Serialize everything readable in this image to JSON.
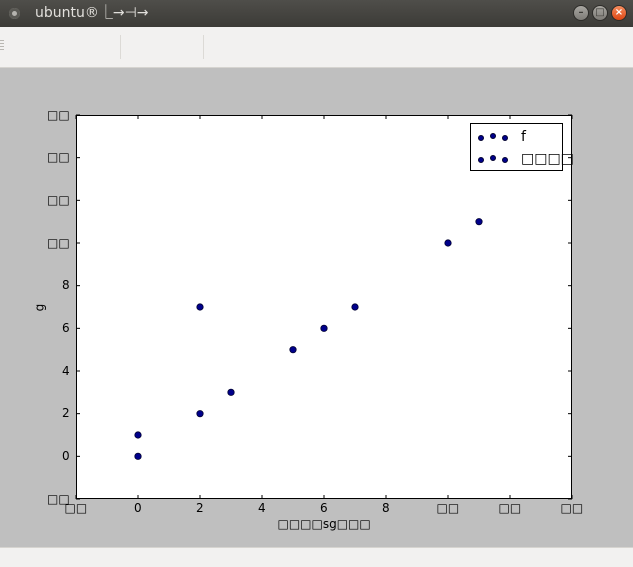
{
  "window": {
    "title": "ubuntu®⎿→⊣→",
    "minimize_glyph": "–",
    "maximize_glyph": "□",
    "close_glyph": "×"
  },
  "chart_data": {
    "type": "scatter",
    "title": "",
    "xlabel": "□□□□sg□□□",
    "ylabel": "g",
    "xlim": [
      -2,
      14
    ],
    "ylim": [
      -2,
      16
    ],
    "x_ticks": [
      -2,
      0,
      2,
      4,
      6,
      8,
      10,
      12,
      14
    ],
    "x_tick_labels": [
      "□□",
      "0",
      "2",
      "4",
      "6",
      "8",
      "□□",
      "□□",
      "□□"
    ],
    "y_ticks": [
      -2,
      0,
      2,
      4,
      6,
      8,
      10,
      12,
      14,
      16
    ],
    "y_tick_labels": [
      "□□",
      "0",
      "2",
      "4",
      "6",
      "8",
      "□□",
      "□□",
      "□□",
      "□□"
    ],
    "grid": false,
    "legend_position": "top-right",
    "series": [
      {
        "name": "f",
        "color": "#00008b",
        "points": [
          [
            0,
            0
          ],
          [
            0,
            1
          ],
          [
            2,
            2
          ],
          [
            2,
            7
          ],
          [
            3,
            3
          ],
          [
            5,
            5
          ],
          [
            6,
            6
          ],
          [
            7,
            7
          ],
          [
            10,
            10
          ],
          [
            11,
            11
          ]
        ]
      },
      {
        "name": "□□□□",
        "color": "#00008b",
        "points": []
      }
    ]
  }
}
